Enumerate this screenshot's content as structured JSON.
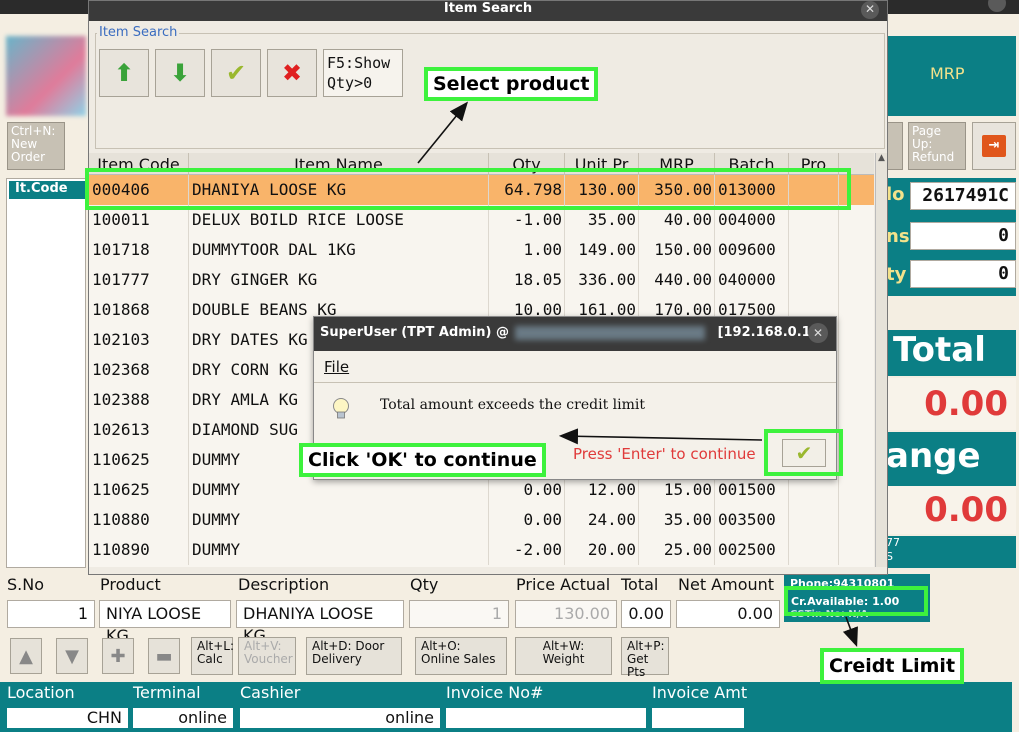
{
  "main": {
    "mrp_label": "MRP",
    "key_buttons": [
      "Ctrl+N: New Order",
      "Page Up: Refund"
    ],
    "itcode_header": "It.Code",
    "right_labels": [
      "lo",
      "ns",
      "ty"
    ],
    "right_values": [
      "2617491C",
      "0",
      "0"
    ],
    "total_label": "Total",
    "total_value": "0.00",
    "change_label": "ange",
    "change_value": "0.00",
    "partial_text": [
      "77",
      "S"
    ],
    "phone_text": "Phone:94310801",
    "credit_available": "Cr.Available: 1.00",
    "credit_extra": "CSTin No: N/A"
  },
  "entry": {
    "headers": {
      "sno": "S.No",
      "product": "Product",
      "description": "Description",
      "qty": "Qty",
      "price": "Price Actual",
      "total": "Total",
      "net": "Net Amount"
    },
    "sno": "1",
    "product": "NIYA LOOSE KG",
    "description": "DHANIYA LOOSE KG",
    "qty": "1",
    "price": "130.00",
    "total": "0.00",
    "net": "0.00"
  },
  "shortcuts": [
    {
      "label": "Alt+L: Calc"
    },
    {
      "label": "Alt+V: Voucher"
    },
    {
      "label": "Alt+D: Door Delivery"
    },
    {
      "label": "Alt+O: Online Sales"
    },
    {
      "label": "Alt+W: Weight"
    },
    {
      "label": "Alt+P: Get Pts"
    }
  ],
  "footer": {
    "location_label": "Location",
    "terminal_label": "Terminal",
    "cashier_label": "Cashier",
    "invoice_label": "Invoice No#",
    "invoice_amt_label": "Invoice Amt",
    "location": "CHN",
    "terminal": "online",
    "cashier": "online",
    "invoice": "",
    "invoice_amt": ""
  },
  "item_search": {
    "title": "Item Search",
    "group_label": "Item Search",
    "show_qty_button": "F5:Show Qty>0",
    "columns": [
      "Item Code",
      "Item Name",
      "Qty",
      "Unit Pr",
      "MRP",
      "Batch",
      "Pro"
    ],
    "rows": [
      {
        "code": "000406",
        "name": "DHANIYA LOOSE KG",
        "qty": "64.798",
        "unit": "130.00",
        "mrp": "350.00",
        "batch": "013000"
      },
      {
        "code": "100011",
        "name": "DELUX BOILD RICE LOOSE",
        "qty": "-1.00",
        "unit": "35.00",
        "mrp": "40.00",
        "batch": "004000"
      },
      {
        "code": "101718",
        "name": "DUMMYTOOR DAL 1KG",
        "qty": "1.00",
        "unit": "149.00",
        "mrp": "150.00",
        "batch": "009600"
      },
      {
        "code": "101777",
        "name": "DRY GINGER KG",
        "qty": "18.05",
        "unit": "336.00",
        "mrp": "440.00",
        "batch": "040000"
      },
      {
        "code": "101868",
        "name": "DOUBLE BEANS KG",
        "qty": "10.00",
        "unit": "161.00",
        "mrp": "170.00",
        "batch": "017500"
      },
      {
        "code": "102103",
        "name": "DRY DATES KG",
        "qty": "",
        "unit": "",
        "mrp": "",
        "batch": ""
      },
      {
        "code": "102368",
        "name": "DRY CORN KG",
        "qty": "",
        "unit": "",
        "mrp": "",
        "batch": ""
      },
      {
        "code": "102388",
        "name": "DRY AMLA KG",
        "qty": "",
        "unit": "",
        "mrp": "",
        "batch": ""
      },
      {
        "code": "102613",
        "name": "DIAMOND SUG",
        "qty": "",
        "unit": "",
        "mrp": "",
        "batch": ""
      },
      {
        "code": "110625",
        "name": "DUMMY",
        "qty": "",
        "unit": "",
        "mrp": "",
        "batch": ""
      },
      {
        "code": "110625",
        "name": "DUMMY",
        "qty": "0.00",
        "unit": "12.00",
        "mrp": "15.00",
        "batch": "001500"
      },
      {
        "code": "110880",
        "name": "DUMMY",
        "qty": "0.00",
        "unit": "24.00",
        "mrp": "35.00",
        "batch": "003500"
      },
      {
        "code": "110890",
        "name": "DUMMY",
        "qty": "-2.00",
        "unit": "20.00",
        "mrp": "25.00",
        "batch": "002500"
      }
    ]
  },
  "alert": {
    "title_prefix": "SuperUser (TPT Admin) @",
    "title_ip": "[192.168.0.1...",
    "menu_file": "File",
    "message": "Total amount exceeds the credit limit",
    "hint": "Press 'Enter' to continue"
  },
  "annotations": {
    "select_product": "Select product",
    "click_ok": "Click 'OK' to continue",
    "credit_limit": "Creidt Limit"
  },
  "colors": {
    "teal": "#0b7f85",
    "highlight_row": "#f9b46a",
    "annotation_green": "#3df23d",
    "amount_red": "#e03a3a"
  }
}
